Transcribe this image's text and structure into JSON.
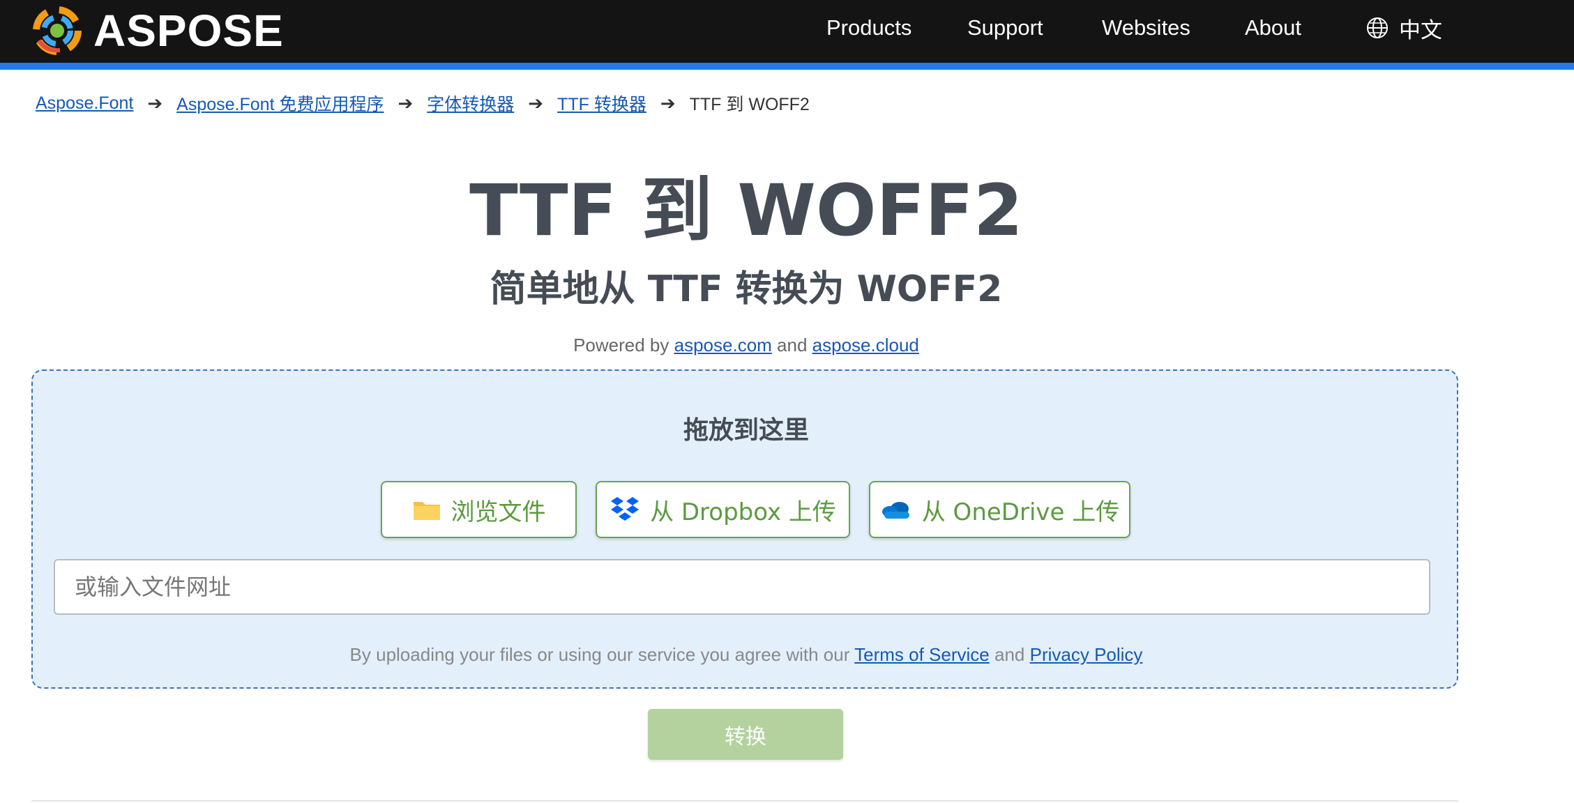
{
  "header": {
    "logo_text": "ASPOSE",
    "nav": {
      "products": "Products",
      "support": "Support",
      "websites": "Websites",
      "about": "About",
      "language": "中文"
    }
  },
  "breadcrumb": {
    "items": [
      "Aspose.Font",
      "Aspose.Font 免费应用程序",
      "字体转换器",
      "TTF 转换器"
    ],
    "current": "TTF 到 WOFF2",
    "separator": "➔"
  },
  "main": {
    "title": "TTF 到 WOFF2",
    "subtitle": "简单地从 TTF 转换为 WOFF2",
    "powered_prefix": "Powered by",
    "powered_link1": "aspose.com",
    "powered_and": "and",
    "powered_link2": "aspose.cloud"
  },
  "dropzone": {
    "title": "拖放到这里",
    "browse_label": "浏览文件",
    "dropbox_label": "从 Dropbox 上传",
    "onedrive_label": "从 OneDrive 上传",
    "url_placeholder": "或输入文件网址",
    "terms_prefix": "By uploading your files or using our service you agree with our",
    "terms_link": "Terms of Service",
    "terms_and": "and",
    "privacy_link": "Privacy Policy"
  },
  "convert_label": "转换",
  "colors": {
    "header_bg": "#141414",
    "accent_blue": "#1f7ce8",
    "link": "#1559b5",
    "green": "#5c9a3f",
    "dropzone_bg": "#e3effb",
    "convert_bg": "#b3d29d"
  }
}
